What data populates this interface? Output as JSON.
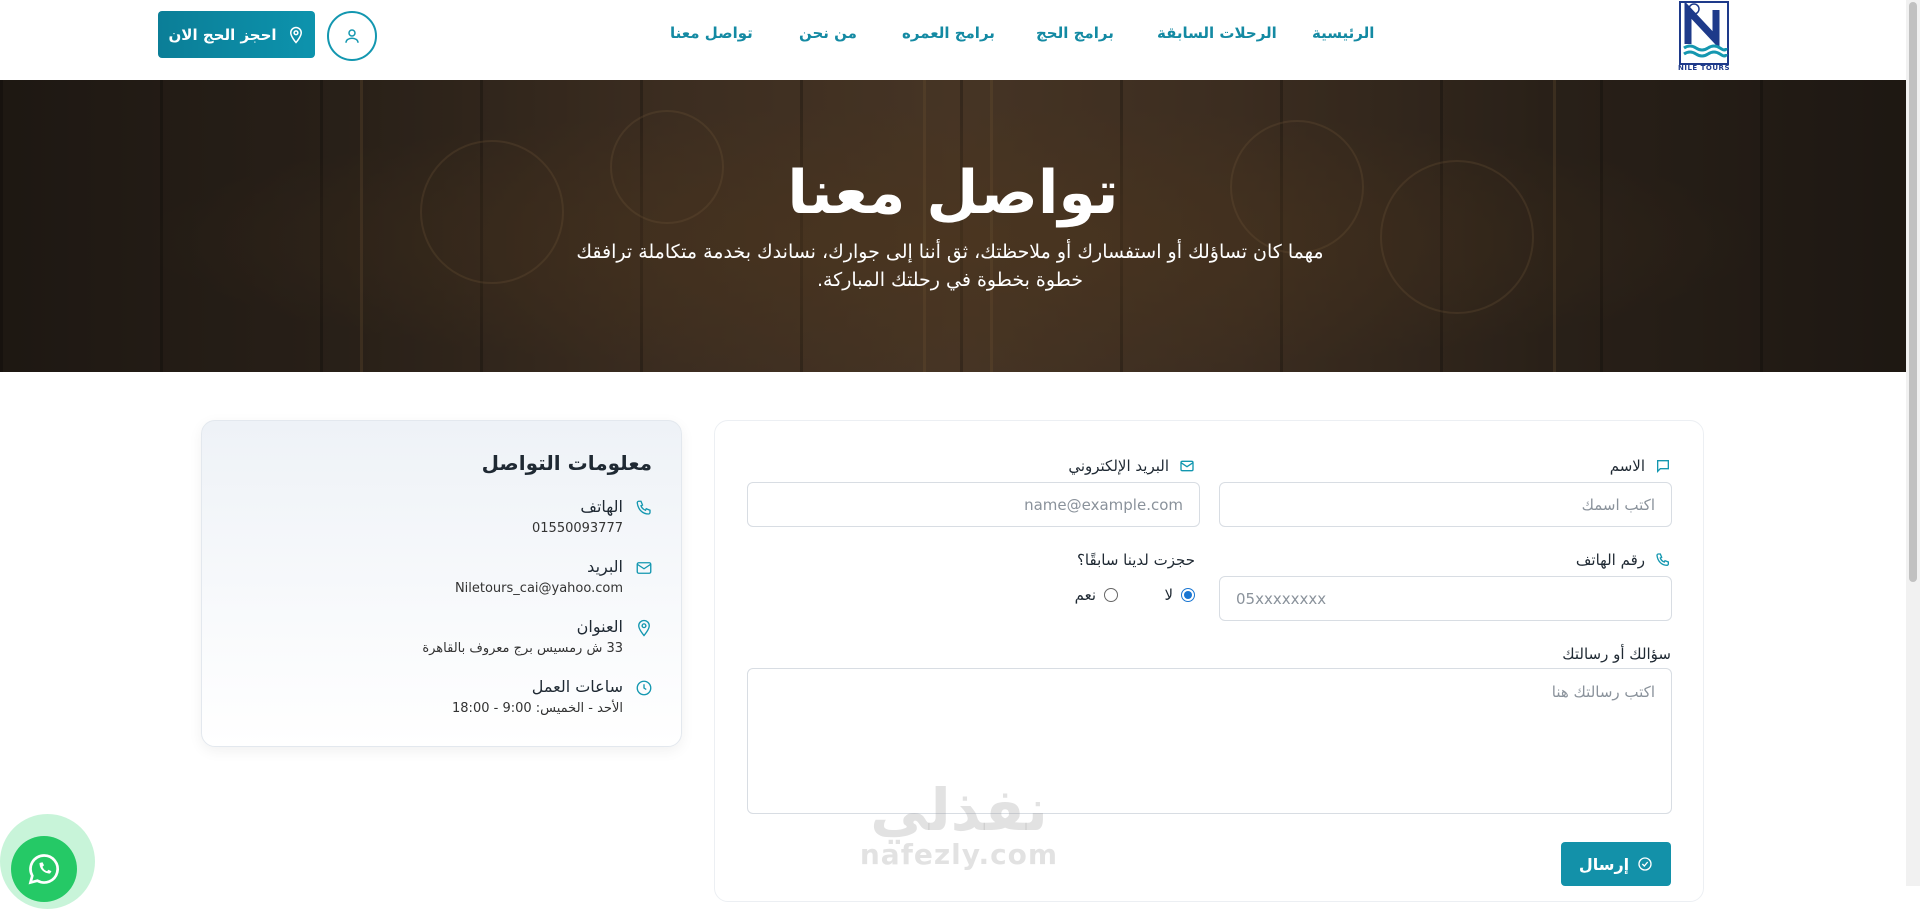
{
  "header": {
    "logo": {
      "text": "NILE TOURS"
    },
    "nav": [
      {
        "label": "الرئيسية"
      },
      {
        "label": "الرحلات السابقة"
      },
      {
        "label": "برامج الحج"
      },
      {
        "label": "برامج العمره"
      },
      {
        "label": "من نحن"
      },
      {
        "label": "تواصل معنا"
      }
    ],
    "book_button": "احجز الحج الان",
    "accent_color": "#148aa3"
  },
  "hero": {
    "title": "تواصل معنا",
    "subtitle": "مهما كان تساؤلك أو استفسارك أو ملاحظتك، ثق أننا إلى جوارك، نساندك بخدمة متكاملة ترافقك خطوة بخطوة في رحلتك المباركة."
  },
  "contact_info": {
    "title": "معلومات التواصل",
    "items": [
      {
        "icon": "phone-icon",
        "label": "الهاتف",
        "value": "01550093777"
      },
      {
        "icon": "mail-icon",
        "label": "البريد",
        "value": "Niletours_cai@yahoo.com"
      },
      {
        "icon": "location-pin-icon",
        "label": "العنوان",
        "value": "33 ش رمسيس برج معروف بالقاهرة"
      },
      {
        "icon": "clock-icon",
        "label": "ساعات العمل",
        "value": "الأحد - الخميس: 9:00 - 18:00"
      }
    ]
  },
  "form": {
    "name_label": "الاسم",
    "name_placeholder": "اكتب اسمك",
    "email_label": "البريد الإلكتروني",
    "email_placeholder": "name@example.com",
    "phone_label": "رقم الهاتف",
    "phone_placeholder": "05xxxxxxxx",
    "booked_label": "حجزت لدينا سابقًا؟",
    "booked_options": [
      {
        "label": "نعم",
        "selected": false
      },
      {
        "label": "لا",
        "selected": true
      }
    ],
    "message_label": "سؤالك أو رسالتك",
    "message_placeholder": "اكتب رسالتك هنا",
    "submit_label": "إرسال"
  },
  "watermark": {
    "arabic": "نفذلي",
    "latin": "nafezly.com"
  }
}
